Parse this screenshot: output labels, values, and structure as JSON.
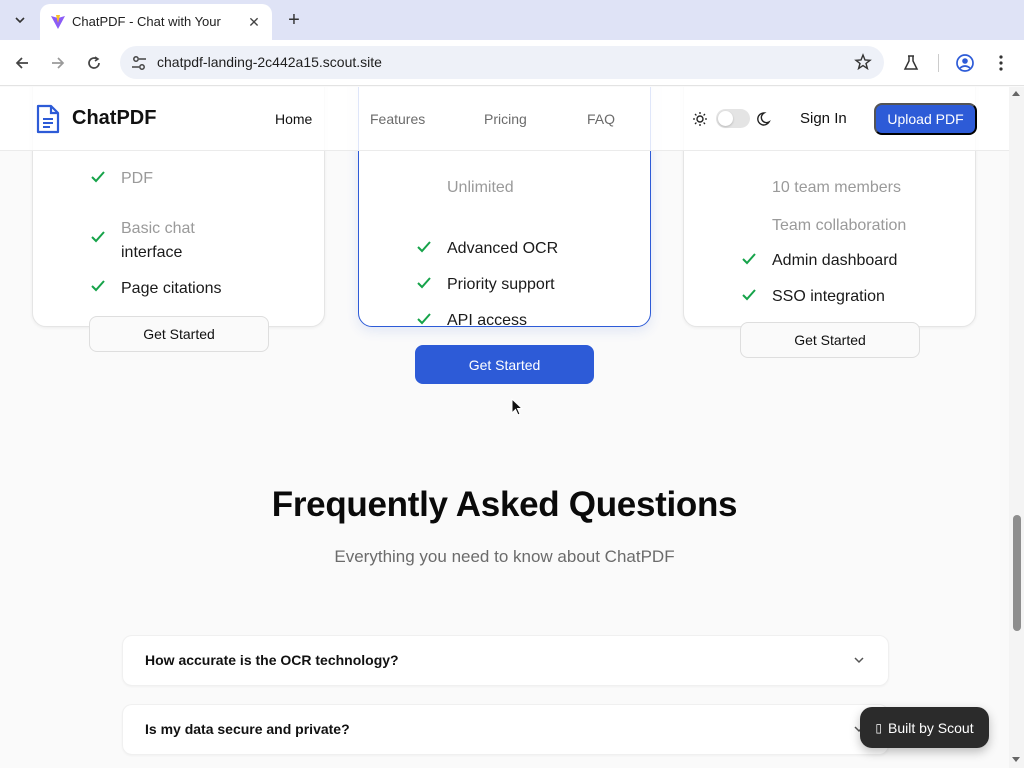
{
  "browser": {
    "tab_title": "ChatPDF - Chat with Your",
    "url": "chatpdf-landing-2c442a15.scout.site"
  },
  "header": {
    "brand": "ChatPDF",
    "nav": [
      "Home",
      "Features",
      "Pricing",
      "FAQ"
    ],
    "active_nav": "Home",
    "signin": "Sign In",
    "upload": "Upload PDF"
  },
  "pricing": {
    "cards": [
      {
        "hidden_features": [
          "PDF",
          "Basic chat"
        ],
        "features": [
          "interface",
          "Page citations"
        ],
        "cta": "Get Started"
      },
      {
        "hidden_features": [
          "Unlimited"
        ],
        "features": [
          "Advanced OCR",
          "Priority support",
          "API access"
        ],
        "cta": "Get Started"
      },
      {
        "hidden_features": [
          "10 team members",
          "Team collaboration"
        ],
        "features": [
          "Admin dashboard",
          "SSO integration"
        ],
        "cta": "Get Started"
      }
    ]
  },
  "faq": {
    "title": "Frequently Asked Questions",
    "subtitle": "Everything you need to know about ChatPDF",
    "items": [
      "How accurate is the OCR technology?",
      "Is my data secure and private?"
    ]
  },
  "badge": {
    "label": "Built by Scout"
  },
  "colors": {
    "accent": "#2d5bd7",
    "check": "#16a34a"
  }
}
